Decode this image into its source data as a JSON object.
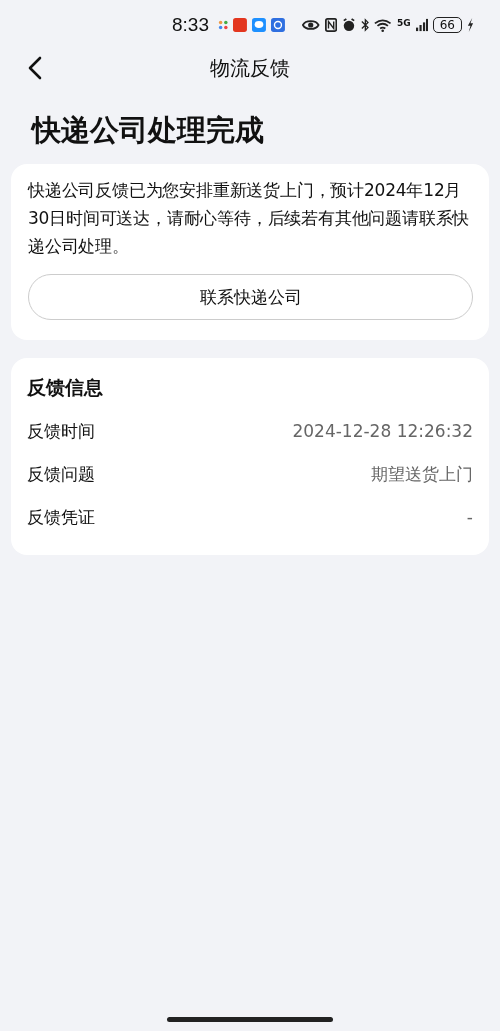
{
  "status_bar": {
    "time": "8:33",
    "network": "5G",
    "battery": "66"
  },
  "nav": {
    "title": "物流反馈"
  },
  "heading": "快递公司处理完成",
  "notice": {
    "text": "快递公司反馈已为您安排重新送货上门，预计2024年12月30日时间可送达，请耐心等待，后续若有其他问题请联系快递公司处理。",
    "button": "联系快递公司"
  },
  "info": {
    "title": "反馈信息",
    "rows": [
      {
        "label": "反馈时间",
        "value": "2024-12-28 12:26:32"
      },
      {
        "label": "反馈问题",
        "value": "期望送货上门"
      },
      {
        "label": "反馈凭证",
        "value": "-"
      }
    ]
  }
}
